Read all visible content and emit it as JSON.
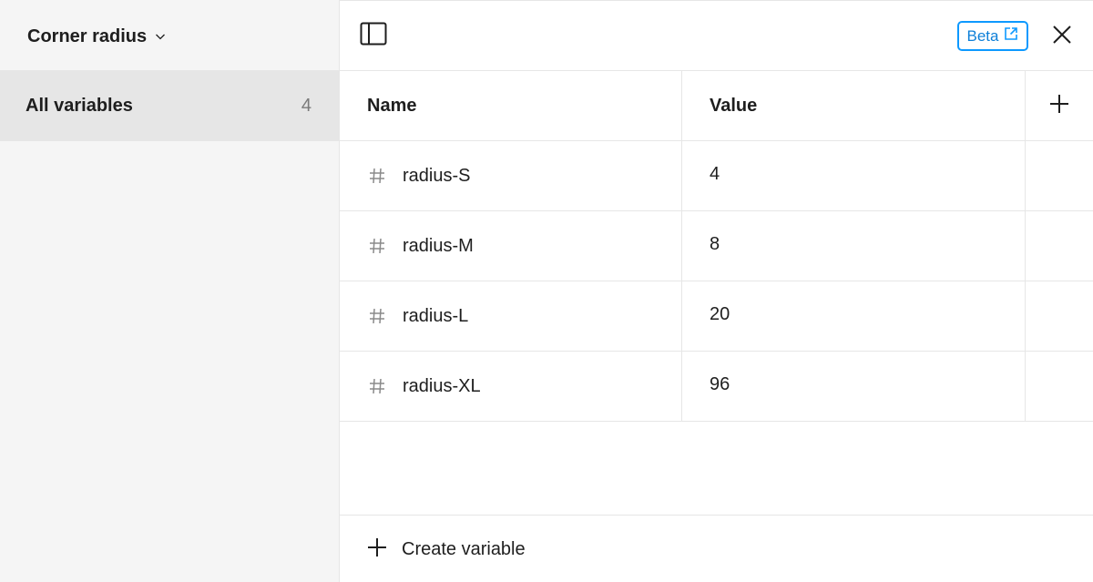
{
  "sidebar": {
    "collection_name": "Corner radius",
    "items": [
      {
        "label": "All variables",
        "count": "4"
      }
    ]
  },
  "toolbar": {
    "beta_label": "Beta"
  },
  "table": {
    "headers": {
      "name": "Name",
      "value": "Value"
    },
    "rows": [
      {
        "name": "radius-S",
        "value": "4"
      },
      {
        "name": "radius-M",
        "value": "8"
      },
      {
        "name": "radius-L",
        "value": "20"
      },
      {
        "name": "radius-XL",
        "value": "96"
      }
    ]
  },
  "footer": {
    "create_label": "Create variable"
  },
  "colors": {
    "accent": "#0d99ff",
    "sidebar_bg": "#f5f5f5",
    "selected_bg": "#e6e6e6",
    "border": "#e6e6e6"
  },
  "icons": {
    "collection_dropdown": "chevron-down-icon",
    "sidebar_toggle": "sidebar-toggle-icon",
    "beta_link": "external-link-icon",
    "close": "close-icon",
    "add_column": "plus-icon",
    "variable_type": "hash-icon",
    "create": "plus-icon"
  }
}
